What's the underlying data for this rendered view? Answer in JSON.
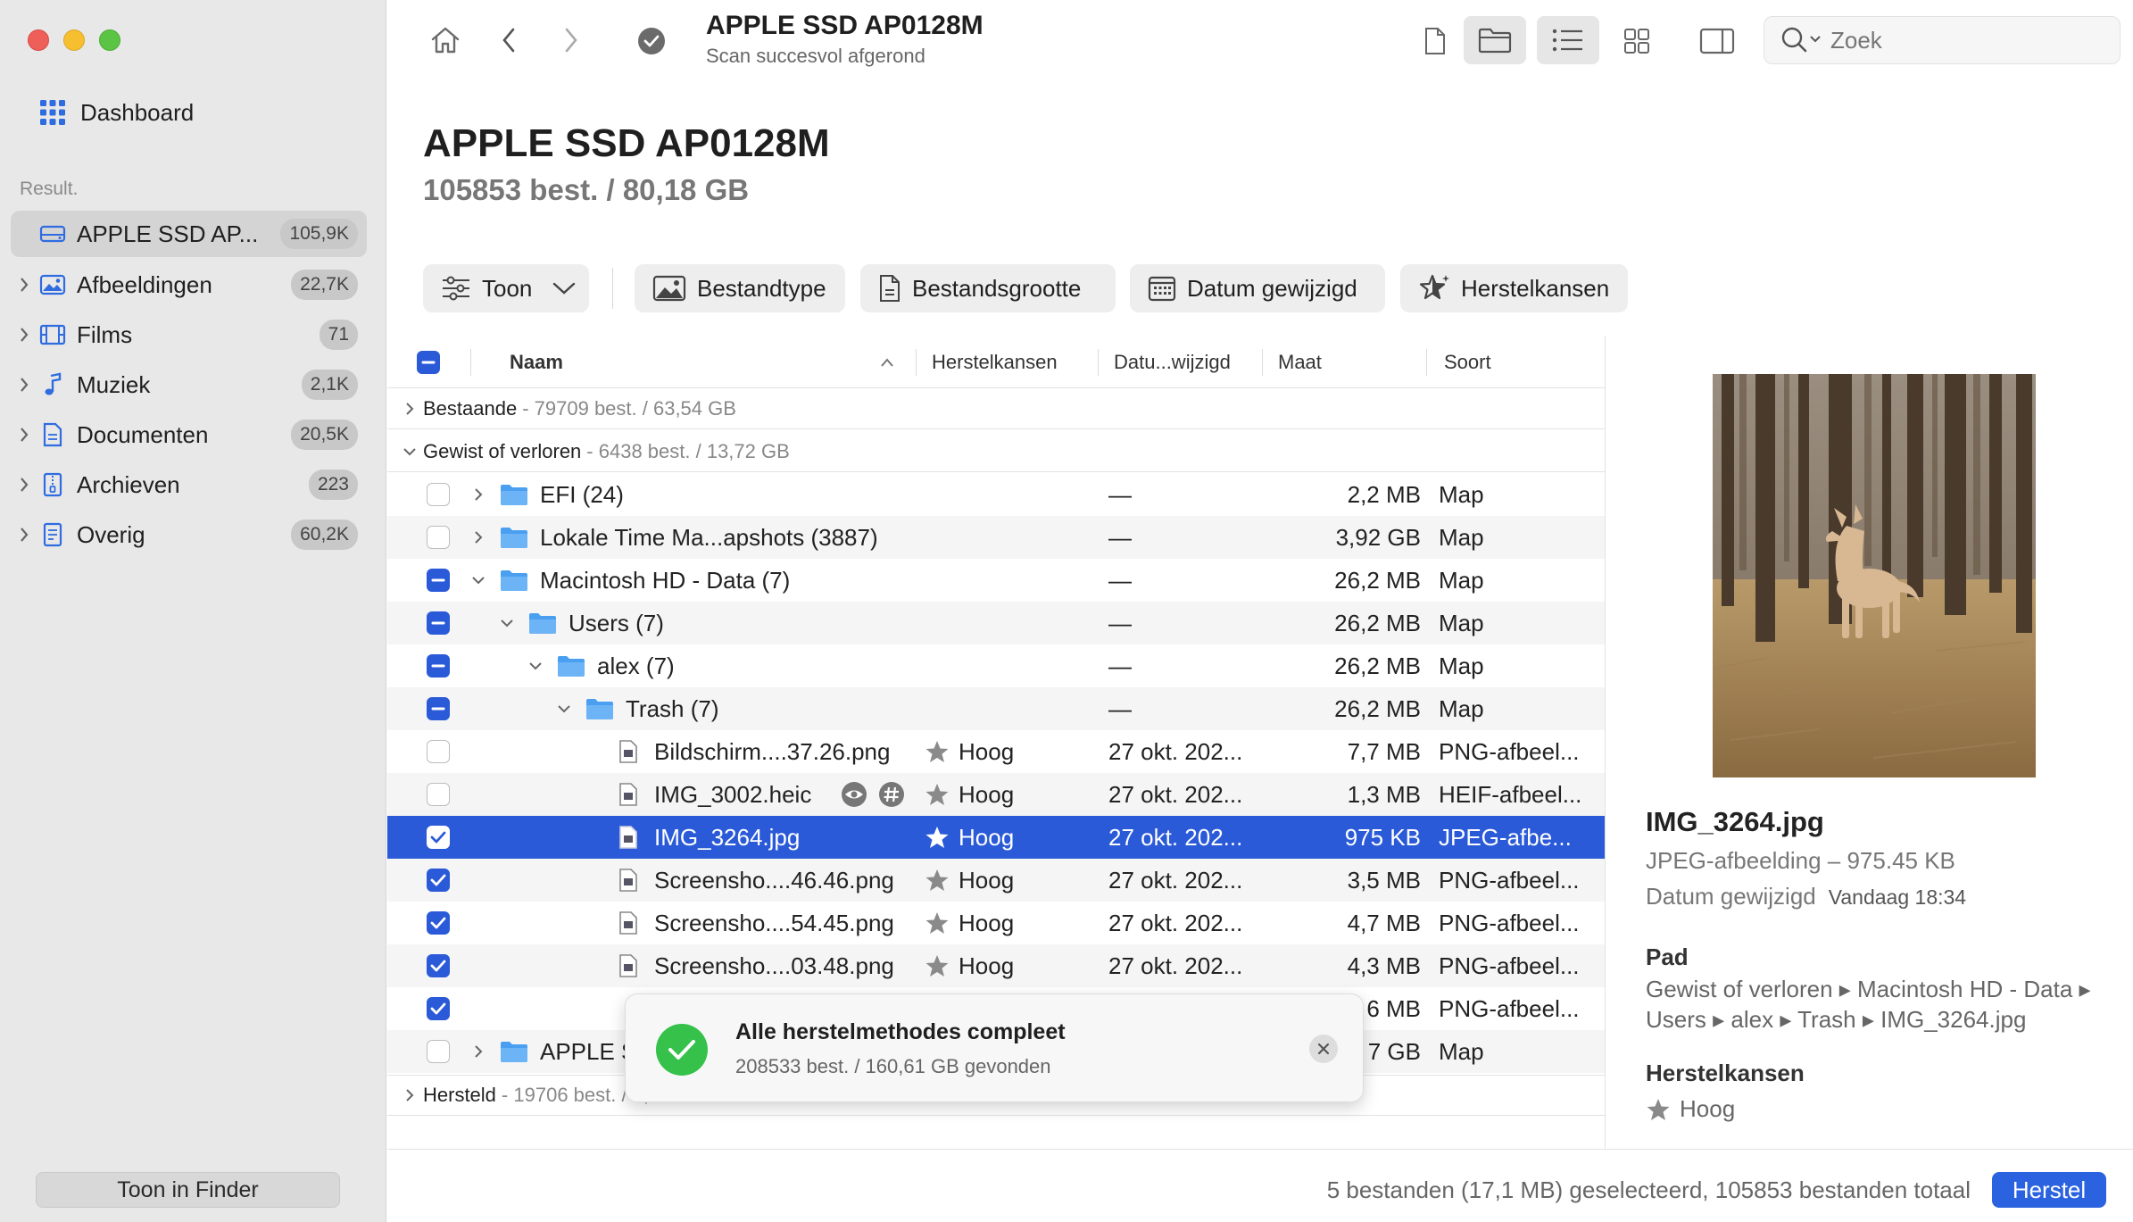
{
  "sidebar": {
    "dashboard_label": "Dashboard",
    "section_label": "Result.",
    "items": [
      {
        "label": "APPLE SSD AP...",
        "count": "105,9K",
        "icon": "disk-icon"
      },
      {
        "label": "Afbeeldingen",
        "count": "22,7K",
        "icon": "image-icon"
      },
      {
        "label": "Films",
        "count": "71",
        "icon": "film-icon"
      },
      {
        "label": "Muziek",
        "count": "2,1K",
        "icon": "music-icon"
      },
      {
        "label": "Documenten",
        "count": "20,5K",
        "icon": "document-icon"
      },
      {
        "label": "Archieven",
        "count": "223",
        "icon": "archive-icon"
      },
      {
        "label": "Overig",
        "count": "60,2K",
        "icon": "other-icon"
      }
    ],
    "finder_button": "Toon in Finder"
  },
  "toolbar": {
    "title": "APPLE SSD AP0128M",
    "subtitle": "Scan succesvol afgerond",
    "search_placeholder": "Zoek"
  },
  "header": {
    "title": "APPLE SSD AP0128M",
    "subtitle": "105853 best. / 80,18 GB"
  },
  "filters": {
    "show": "Toon",
    "filetype": "Bestandtype",
    "filesize": "Bestandsgrootte",
    "date": "Datum gewijzigd",
    "chances": "Herstelkansen"
  },
  "table": {
    "columns": {
      "name": "Naam",
      "chances": "Herstelkansen",
      "date": "Datu...wijzigd",
      "size": "Maat",
      "type": "Soort"
    },
    "groups": {
      "existing": {
        "label": "Bestaande",
        "meta": "79709 best. / 63,54 GB"
      },
      "deleted": {
        "label": "Gewist of verloren",
        "meta": "6438 best. / 13,72 GB"
      },
      "recovered": {
        "label": "Hersteld",
        "meta": "19706 best. / 2,02 GB"
      }
    },
    "rows": [
      {
        "name": "EFI (24)",
        "chance": "",
        "date": "—",
        "size": "2,2 MB",
        "type": "Map"
      },
      {
        "name": "Lokale Time Ma...apshots (3887)",
        "chance": "",
        "date": "—",
        "size": "3,92 GB",
        "type": "Map"
      },
      {
        "name": "Macintosh HD - Data (7)",
        "chance": "",
        "date": "—",
        "size": "26,2 MB",
        "type": "Map"
      },
      {
        "name": "Users (7)",
        "chance": "",
        "date": "—",
        "size": "26,2 MB",
        "type": "Map"
      },
      {
        "name": "alex (7)",
        "chance": "",
        "date": "—",
        "size": "26,2 MB",
        "type": "Map"
      },
      {
        "name": "Trash (7)",
        "chance": "",
        "date": "—",
        "size": "26,2 MB",
        "type": "Map"
      },
      {
        "name": "Bildschirm....37.26.png",
        "chance": "Hoog",
        "date": "27 okt. 202...",
        "size": "7,7 MB",
        "type": "PNG-afbeel..."
      },
      {
        "name": "IMG_3002.heic",
        "chance": "Hoog",
        "date": "27 okt. 202...",
        "size": "1,3 MB",
        "type": "HEIF-afbeel..."
      },
      {
        "name": "IMG_3264.jpg",
        "chance": "Hoog",
        "date": "27 okt. 202...",
        "size": "975 KB",
        "type": "JPEG-afbe..."
      },
      {
        "name": "Screensho....46.46.png",
        "chance": "Hoog",
        "date": "27 okt. 202...",
        "size": "3,5 MB",
        "type": "PNG-afbeel..."
      },
      {
        "name": "Screensho....54.45.png",
        "chance": "Hoog",
        "date": "27 okt. 202...",
        "size": "4,7 MB",
        "type": "PNG-afbeel..."
      },
      {
        "name": "Screensho....03.48.png",
        "chance": "Hoog",
        "date": "27 okt. 202...",
        "size": "4,3 MB",
        "type": "PNG-afbeel..."
      },
      {
        "name": "",
        "chance": "",
        "date": "",
        "size": "6 MB",
        "type": "PNG-afbeel..."
      },
      {
        "name": "APPLE S",
        "chance": "",
        "date": "",
        "size": "7 GB",
        "type": "Map"
      }
    ]
  },
  "toast": {
    "title": "Alle herstelmethodes compleet",
    "subtitle": "208533 best. / 160,61 GB gevonden"
  },
  "detail": {
    "name": "IMG_3264.jpg",
    "type": "JPEG-afbeelding – 975.45 KB",
    "date_label": "Datum gewijzigd",
    "date_value": "Vandaag 18:34",
    "path_label": "Pad",
    "path_line1": "Gewist of verloren ▸ Macintosh HD - Data ▸",
    "path_line2": "Users ▸ alex ▸ Trash ▸ IMG_3264.jpg",
    "chance_label": "Herstelkansen",
    "chance_value": "Hoog"
  },
  "status": {
    "text": "5 bestanden (17,1 MB) geselecteerd, 105853 bestanden totaal",
    "recover_button": "Herstel"
  },
  "colors": {
    "accent": "#2a5ad8",
    "folder": "#4a9ff0",
    "success": "#35c14a"
  }
}
